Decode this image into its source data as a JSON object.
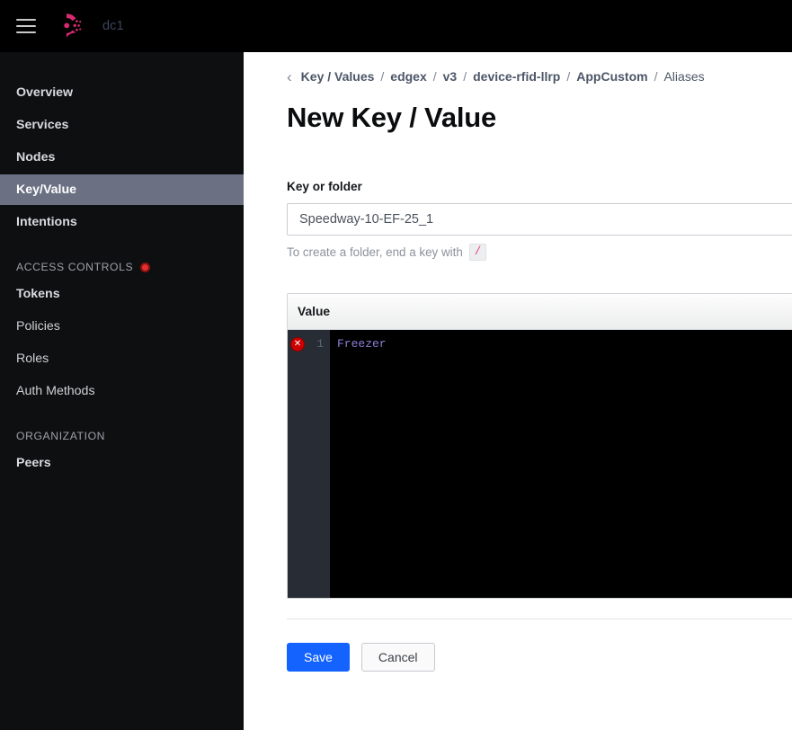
{
  "topnav": {
    "menu_icon": "hamburger-icon",
    "logo_icon": "consul-logo-icon",
    "datacenter": "dc1"
  },
  "sidebar": {
    "items": [
      {
        "label": "Overview",
        "active": false
      },
      {
        "label": "Services",
        "active": false
      },
      {
        "label": "Nodes",
        "active": false
      },
      {
        "label": "Key/Value",
        "active": true
      },
      {
        "label": "Intentions",
        "active": false
      }
    ],
    "sections": [
      {
        "title": "ACCESS CONTROLS",
        "badge_icon": "red-dot-icon",
        "items": [
          {
            "label": "Tokens"
          },
          {
            "label": "Policies"
          },
          {
            "label": "Roles"
          },
          {
            "label": "Auth Methods"
          }
        ]
      },
      {
        "title": "ORGANIZATION",
        "items": [
          {
            "label": "Peers"
          }
        ]
      }
    ]
  },
  "main": {
    "breadcrumb": {
      "back_icon": "chevron-left-icon",
      "separator": "/",
      "items": [
        {
          "label": "Key / Values"
        },
        {
          "label": "edgex"
        },
        {
          "label": "v3"
        },
        {
          "label": "device-rfid-llrp"
        },
        {
          "label": "AppCustom"
        },
        {
          "label": "Aliases"
        }
      ]
    },
    "title": "New Key / Value",
    "key_field": {
      "label": "Key or folder",
      "value": "Speedway-10-EF-25_1",
      "placeholder": "Key or folder",
      "helper_prefix": "To create a folder, end a key with",
      "helper_code": "/"
    },
    "editor": {
      "header": "Value",
      "error_icon": "error-circle-icon",
      "lines": [
        {
          "number": "1",
          "text": "Freezer"
        }
      ]
    },
    "actions": {
      "save_label": "Save",
      "cancel_label": "Cancel"
    }
  },
  "colors": {
    "brand_pink": "#d62b71",
    "accent_blue": "#1563ff",
    "nav_active_bg": "#6b7183",
    "error_red": "#cc0000",
    "code_text": "#8a7fd4",
    "badge_pink": "#e0457b"
  }
}
